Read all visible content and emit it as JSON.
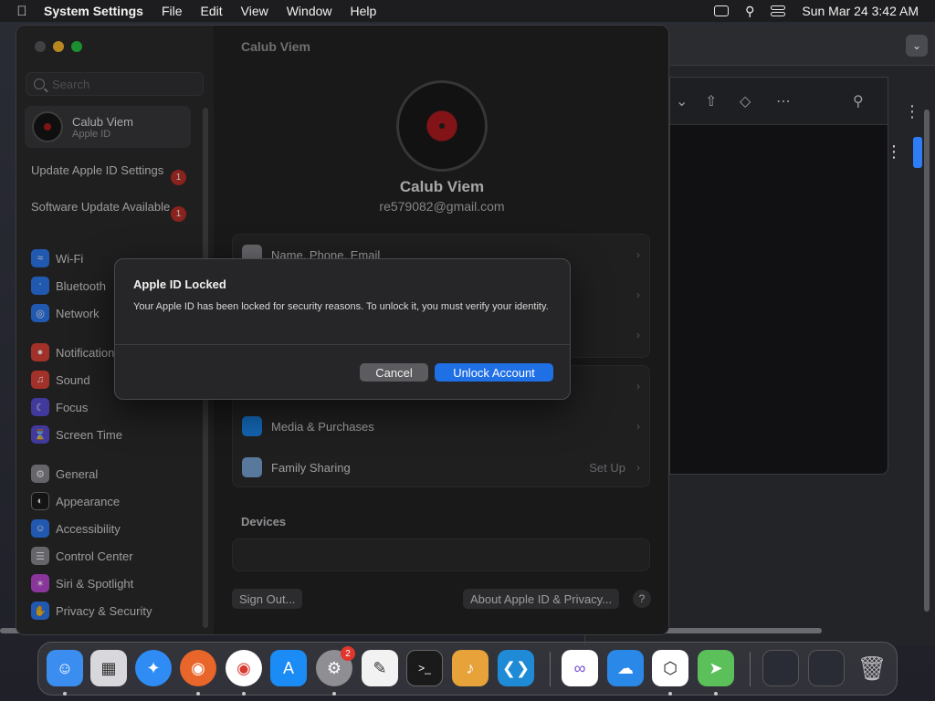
{
  "menubar": {
    "app_name": "System Settings",
    "items": [
      "File",
      "Edit",
      "View",
      "Window",
      "Help"
    ],
    "clock": "Sun Mar 24  3:42 AM"
  },
  "sidebar": {
    "search_placeholder": "Search",
    "account": {
      "name": "Calub Viem",
      "subtitle": "Apple ID"
    },
    "notices": [
      {
        "label": "Update Apple ID Settings",
        "badge": "1"
      },
      {
        "label": "Software Update Available",
        "badge": "1"
      }
    ],
    "items": [
      {
        "label": "Wi-Fi",
        "icon": "wifi-icon",
        "color": "#2f7cf6"
      },
      {
        "label": "Bluetooth",
        "icon": "bluetooth-icon",
        "color": "#2f7cf6"
      },
      {
        "label": "Network",
        "icon": "globe-icon",
        "color": "#2f7cf6"
      },
      {
        "label": "Notifications",
        "icon": "bell-icon",
        "color": "#e0443a"
      },
      {
        "label": "Sound",
        "icon": "speaker-icon",
        "color": "#e0443a"
      },
      {
        "label": "Focus",
        "icon": "moon-icon",
        "color": "#5b4fd8"
      },
      {
        "label": "Screen Time",
        "icon": "hourglass-icon",
        "color": "#5b4fd8"
      },
      {
        "label": "General",
        "icon": "gear-icon",
        "color": "#8e8e93"
      },
      {
        "label": "Appearance",
        "icon": "appearance-icon",
        "color": "#1c1c1e"
      },
      {
        "label": "Accessibility",
        "icon": "accessibility-icon",
        "color": "#2f7cf6"
      },
      {
        "label": "Control Center",
        "icon": "control-center-icon",
        "color": "#8e8e93"
      },
      {
        "label": "Siri & Spotlight",
        "icon": "siri-icon",
        "color": "#c04ad8"
      },
      {
        "label": "Privacy & Security",
        "icon": "hand-icon",
        "color": "#2f7cf6"
      }
    ]
  },
  "main": {
    "title": "Calub Viem",
    "profile": {
      "name": "Calub Viem",
      "email": "re579082@gmail.com"
    },
    "rows": [
      {
        "label": "Name, Phone, Email"
      },
      {
        "label": "Media & Purchases"
      },
      {
        "label": "Family Sharing",
        "value": "Set Up"
      }
    ],
    "devices_title": "Devices",
    "sign_out": "Sign Out...",
    "about": "About Apple ID & Privacy...",
    "help": "?"
  },
  "dialog": {
    "title": "Apple ID Locked",
    "message": "Your Apple ID has been locked for security reasons. To unlock it, you must verify your identity.",
    "cancel": "Cancel",
    "confirm": "Unlock Account"
  },
  "dock": {
    "apps": [
      {
        "name": "finder-icon",
        "color": "#3b8ef0"
      },
      {
        "name": "launchpad-icon",
        "color": "#d8d8dc"
      },
      {
        "name": "safari-icon",
        "color": "#2f8cf5"
      },
      {
        "name": "firefox-icon",
        "color": "#e8662a"
      },
      {
        "name": "chrome-icon",
        "color": "#ffffff"
      },
      {
        "name": "app-store-icon",
        "color": "#1b8cf5"
      },
      {
        "name": "system-settings-icon",
        "color": "#8e8e93",
        "badge": "2"
      },
      {
        "name": "textedit-icon",
        "color": "#f2f2f2"
      },
      {
        "name": "terminal-icon",
        "color": "#1a1a1a"
      },
      {
        "name": "garageband-icon",
        "color": "#e8a23a"
      },
      {
        "name": "vscode-icon",
        "color": "#1f8ad6"
      },
      {
        "name": "visual-studio-icon",
        "color": "#ffffff"
      },
      {
        "name": "weather-icon",
        "color": "#2a88e8"
      },
      {
        "name": "outline-vpn-icon",
        "color": "#ffffff"
      },
      {
        "name": "maps-icon",
        "color": "#5bbf5a"
      },
      {
        "name": "window-thumbnail-icon",
        "color": "#2a2c35"
      },
      {
        "name": "window-thumbnail-icon",
        "color": "#2a2c35"
      },
      {
        "name": "trash-icon",
        "color": "#b8b8bc"
      }
    ]
  }
}
